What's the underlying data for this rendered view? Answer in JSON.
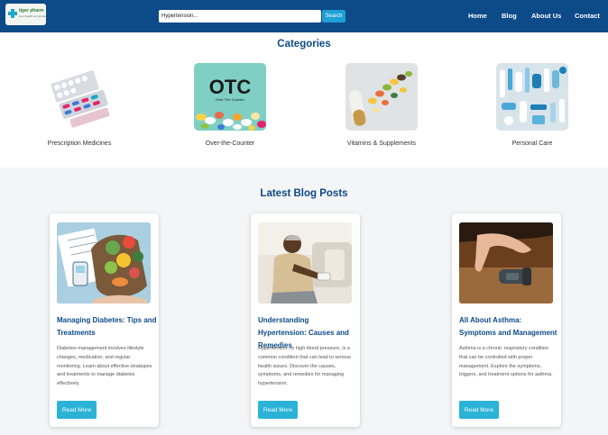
{
  "header": {
    "logo": {
      "brand": "tiger pharm",
      "tagline": "your health our priority"
    },
    "search": {
      "value": "Hypertension...",
      "button_label": "Search"
    },
    "nav": [
      "Home",
      "Blog",
      "About Us",
      "Contact"
    ]
  },
  "categories": {
    "title": "Categories",
    "items": [
      {
        "label": "Prescription Medicines"
      },
      {
        "label": "Over-the-Counter",
        "image_text": "OTC",
        "image_subtext": "Over The Counter"
      },
      {
        "label": "Vitamins & Supplements"
      },
      {
        "label": "Personal Care"
      }
    ]
  },
  "blog": {
    "title": "Latest Blog Posts",
    "posts": [
      {
        "title": "Managing Diabetes: Tips and Treatments",
        "excerpt": "Diabetes management involves lifestyle changes, medication, and regular monitoring. Learn about effective strategies and treatments to manage diabetes effectively.",
        "button": "Read More"
      },
      {
        "title": "Understanding Hypertension: Causes and Remedies",
        "excerpt": "Hypertension, or high blood pressure, is a common condition that can lead to serious health issues. Discover the causes, symptoms, and remedies for managing hypertension.",
        "button": "Read More"
      },
      {
        "title": "All About Asthma: Symptoms and Management",
        "excerpt": "Asthma is a chronic respiratory condition that can be controlled with proper management. Explore the symptoms, triggers, and treatment options for asthma.",
        "button": "Read More"
      }
    ]
  },
  "colors": {
    "primary": "#0c4a88",
    "accent": "#2ab3d6",
    "search_button": "#1e9fd5"
  }
}
